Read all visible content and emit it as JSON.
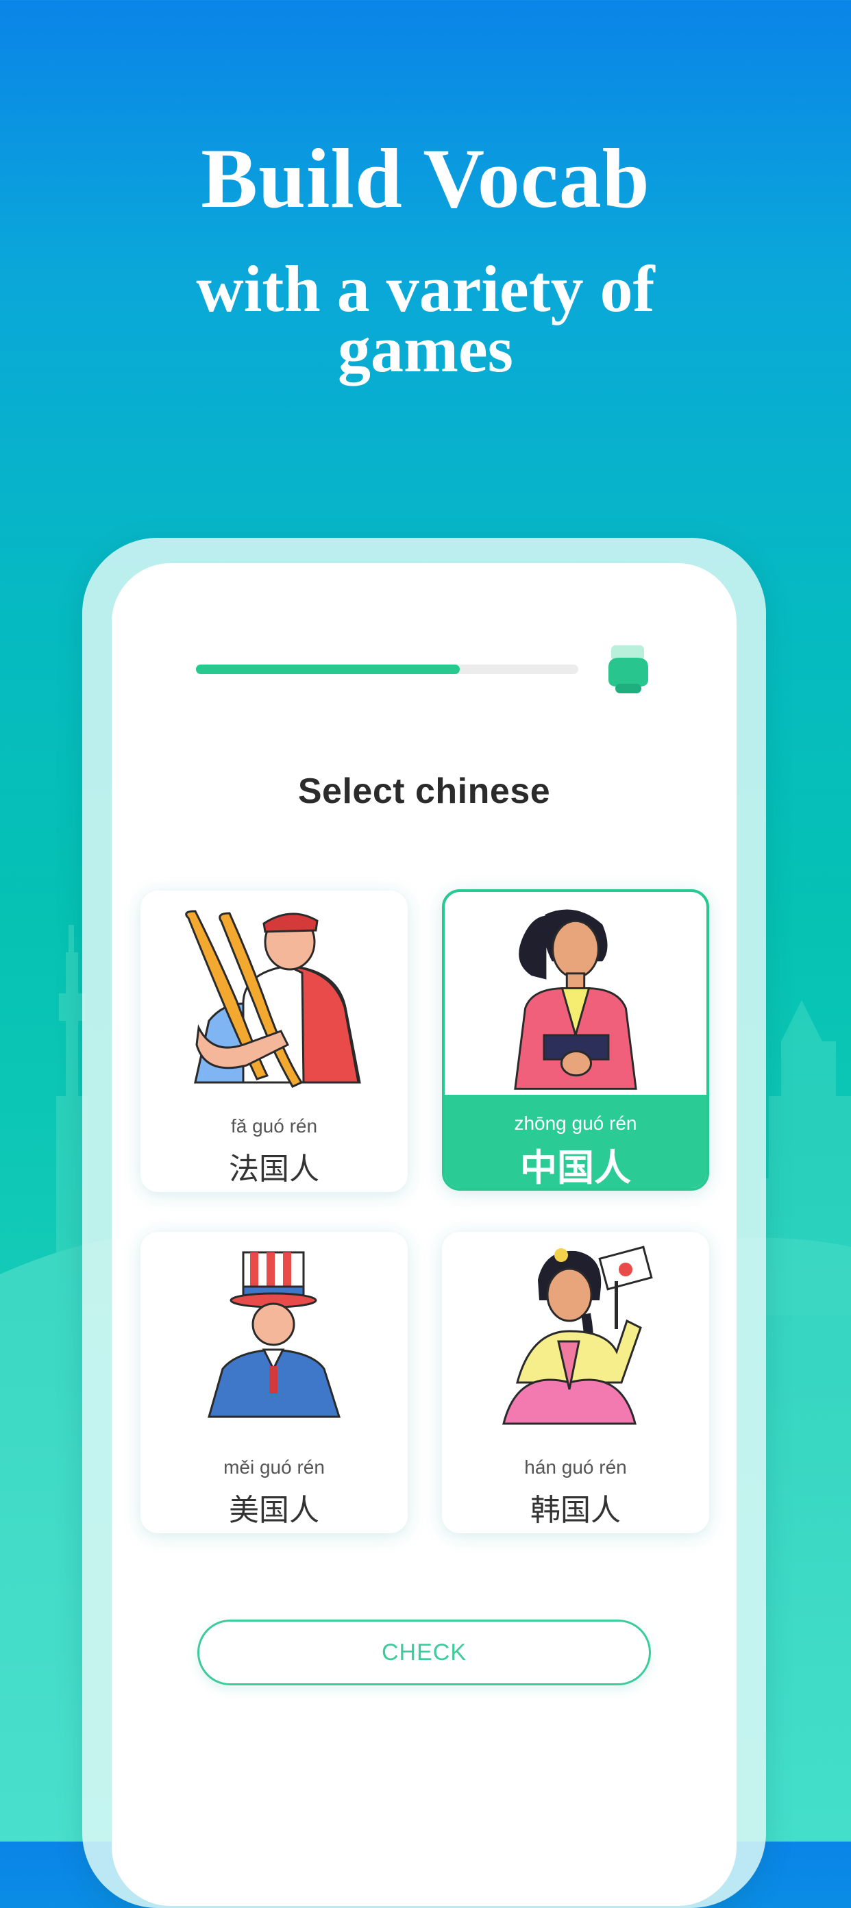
{
  "hero": {
    "title": "Build Vocab",
    "subtitle_line1": "with a variety of",
    "subtitle_line2": "games"
  },
  "progress": {
    "value": 0.69
  },
  "quiz": {
    "prompt": "Select chinese",
    "options": [
      {
        "pinyin": "fǎ  guó rén",
        "hanzi": "法国人",
        "icon": "french-man-illustration",
        "selected": false
      },
      {
        "pinyin": "zhōng guó rén",
        "hanzi": "中国人",
        "icon": "chinese-woman-illustration",
        "selected": true
      },
      {
        "pinyin": "měi guó rén",
        "hanzi": "美国人",
        "icon": "american-man-illustration",
        "selected": false
      },
      {
        "pinyin": "hán guó rén",
        "hanzi": "韩国人",
        "icon": "korean-woman-illustration",
        "selected": false
      }
    ],
    "check_label": "CHECK"
  },
  "colors": {
    "accent": "#27c990",
    "background_top": "#0a84e8",
    "background_bottom": "#2fdcc8"
  }
}
